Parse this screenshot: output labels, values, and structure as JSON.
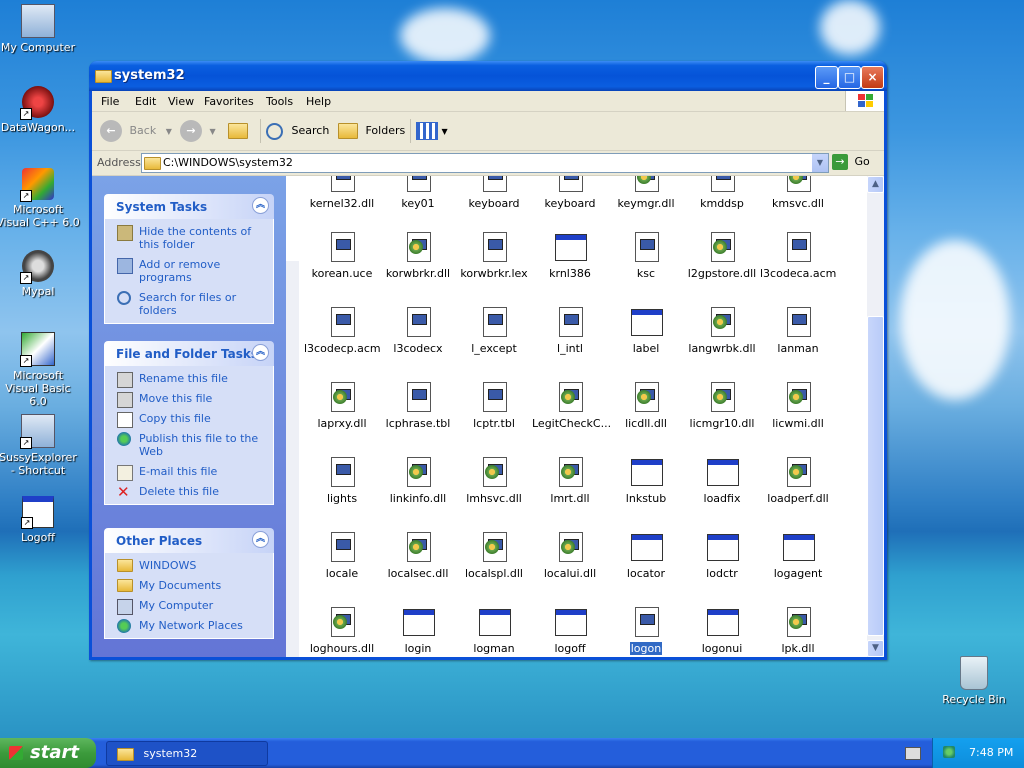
{
  "window": {
    "title": "system32"
  },
  "menu": [
    "File",
    "Edit",
    "View",
    "Favorites",
    "Tools",
    "Help"
  ],
  "toolbar": {
    "back": "Back",
    "search": "Search",
    "folders": "Folders"
  },
  "address": {
    "label": "Address",
    "value": "C:\\WINDOWS\\system32",
    "go": "Go"
  },
  "panes": {
    "system_tasks": {
      "title": "System Tasks",
      "items": [
        "Hide the contents of this folder",
        "Add or remove programs",
        "Search for files or folders"
      ]
    },
    "file_tasks": {
      "title": "File and Folder Tasks",
      "items": [
        "Rename this file",
        "Move this file",
        "Copy this file",
        "Publish this file to the Web",
        "E-mail this file",
        "Delete this file"
      ]
    },
    "other_places": {
      "title": "Other Places",
      "items": [
        "WINDOWS",
        "My Documents",
        "My Computer",
        "My Network Places"
      ]
    }
  },
  "files": [
    [
      "kernel32.dll",
      "key01",
      "keyboard",
      "keyboard",
      "keymgr.dll",
      "kmddsp",
      "kmsvc.dll"
    ],
    [
      "korean.uce",
      "korwbrkr.dll",
      "korwbrkr.lex",
      "krnl386",
      "ksc",
      "l2gpstore.dll",
      "l3codeca.acm"
    ],
    [
      "l3codecp.acm",
      "l3codecx",
      "l_except",
      "l_intl",
      "label",
      "langwrbk.dll",
      "lanman"
    ],
    [
      "laprxy.dll",
      "lcphrase.tbl",
      "lcptr.tbl",
      "LegitCheckC...",
      "licdll.dll",
      "licmgr10.dll",
      "licwmi.dll"
    ],
    [
      "lights",
      "linkinfo.dll",
      "lmhsvc.dll",
      "lmrt.dll",
      "lnkstub",
      "loadfix",
      "loadperf.dll"
    ],
    [
      "locale",
      "localsec.dll",
      "localspl.dll",
      "localui.dll",
      "locator",
      "lodctr",
      "logagent"
    ],
    [
      "loghours.dll",
      "login",
      "logman",
      "logoff",
      "logon",
      "logonui",
      "lpk.dll"
    ]
  ],
  "selected_file": "logon",
  "desktop_icons": [
    "My Computer",
    "DataWagon...",
    "Microsoft Visual C++ 6.0",
    "Mypal",
    "Microsoft Visual Basic 6.0",
    "SussyExplorer - Shortcut",
    "Logoff",
    "Recycle Bin"
  ],
  "taskbar": {
    "start": "start",
    "task": "system32",
    "clock": "7:48 PM"
  }
}
